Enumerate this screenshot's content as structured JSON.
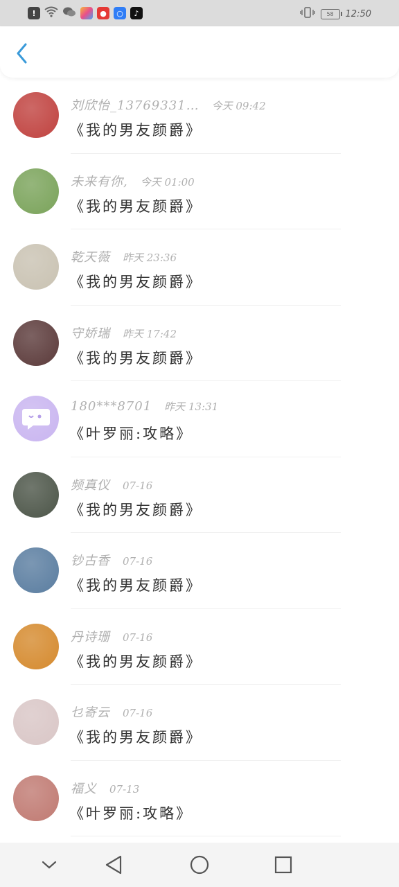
{
  "status_bar": {
    "time": "12:50",
    "battery_label": "58",
    "icons": [
      "alert-icon",
      "wifi-icon",
      "wechat-icon",
      "app-icon-1",
      "app-icon-2",
      "app-icon-3",
      "tiktok-icon"
    ]
  },
  "header": {
    "back_icon": "chevron-left-icon"
  },
  "messages": [
    {
      "name": "刘欣怡_13769331…",
      "time": "今天 09:42",
      "message": "《我的男友颜爵》",
      "avatar": "#c0423f"
    },
    {
      "name": "未来有你,",
      "time": "今天 01:00",
      "message": "《我的男友颜爵》",
      "avatar": "#7aa35a"
    },
    {
      "name": "乾天薇",
      "time": "昨天 23:36",
      "message": "《我的男友颜爵》",
      "avatar": "#c9c2b2"
    },
    {
      "name": "守娇瑞",
      "time": "昨天 17:42",
      "message": "《我的男友颜爵》",
      "avatar": "#5b3a3a"
    },
    {
      "name": "180***8701",
      "time": "昨天 13:31",
      "message": "《叶罗丽:攻略》",
      "avatar": "#c9b5f0"
    },
    {
      "name": "频真仪",
      "time": "07-16",
      "message": "《我的男友颜爵》",
      "avatar": "#4c5548"
    },
    {
      "name": "钞古香",
      "time": "07-16",
      "message": "《我的男友颜爵》",
      "avatar": "#5a7da0"
    },
    {
      "name": "丹诗珊",
      "time": "07-16",
      "message": "《我的男友颜爵》",
      "avatar": "#d58a2e"
    },
    {
      "name": "乜寄云",
      "time": "07-16",
      "message": "《我的男友颜爵》",
      "avatar": "#d9c6c6"
    },
    {
      "name": "福义",
      "time": "07-13",
      "message": "《叶罗丽:攻略》",
      "avatar": "#c07a72"
    }
  ],
  "navbar": {
    "buttons": [
      "chevron-down-icon",
      "back-triangle-icon",
      "home-circle-icon",
      "recent-square-icon"
    ]
  }
}
